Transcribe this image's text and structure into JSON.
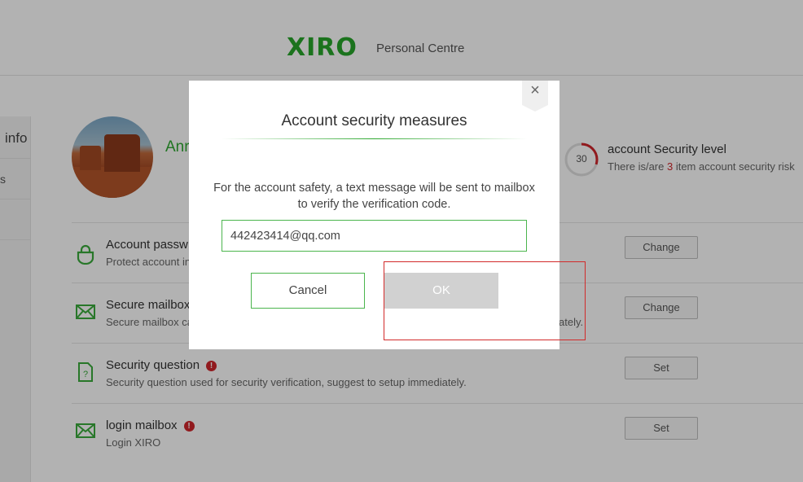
{
  "header": {
    "logo": "XIRO",
    "subtitle": "Personal Centre"
  },
  "sidebar": {
    "items": [
      {
        "label": "info"
      },
      {
        "label": "s"
      }
    ]
  },
  "profile": {
    "username": "Anr"
  },
  "security_level": {
    "score": "30",
    "score_fraction": 0.3,
    "title": "account Security level",
    "desc_prefix": "There is/are ",
    "risk_count": "3",
    "desc_suffix": " item account security risk"
  },
  "rows": [
    {
      "title": "Account passw",
      "desc": "Protect account in",
      "button": "Change",
      "icon": "lock-icon"
    },
    {
      "title": "Secure mailbox",
      "desc": "Secure mailbox ca",
      "desc_tail": "ately.",
      "button": "Change",
      "icon": "envelope-icon"
    },
    {
      "title": "Security question",
      "desc": "Security question used for security verification, suggest to setup immediately.",
      "button": "Set",
      "icon": "question-document-icon",
      "warning": "!"
    },
    {
      "title": "login mailbox",
      "desc": "Login XIRO",
      "button": "Set",
      "icon": "envelope-icon",
      "warning": "!"
    }
  ],
  "dialog": {
    "close": "×",
    "title": "Account security measures",
    "message": "For the account safety, a text message will be sent to mailbox to verify the verification code.",
    "email_value": "442423414@qq.com",
    "cancel_label": "Cancel",
    "ok_label": "OK"
  },
  "colors": {
    "brand": "#2ea830",
    "danger": "#d0262b",
    "overlay": "rgba(0,0,0,0.3)",
    "disabled_button": "#d1d1d1"
  }
}
